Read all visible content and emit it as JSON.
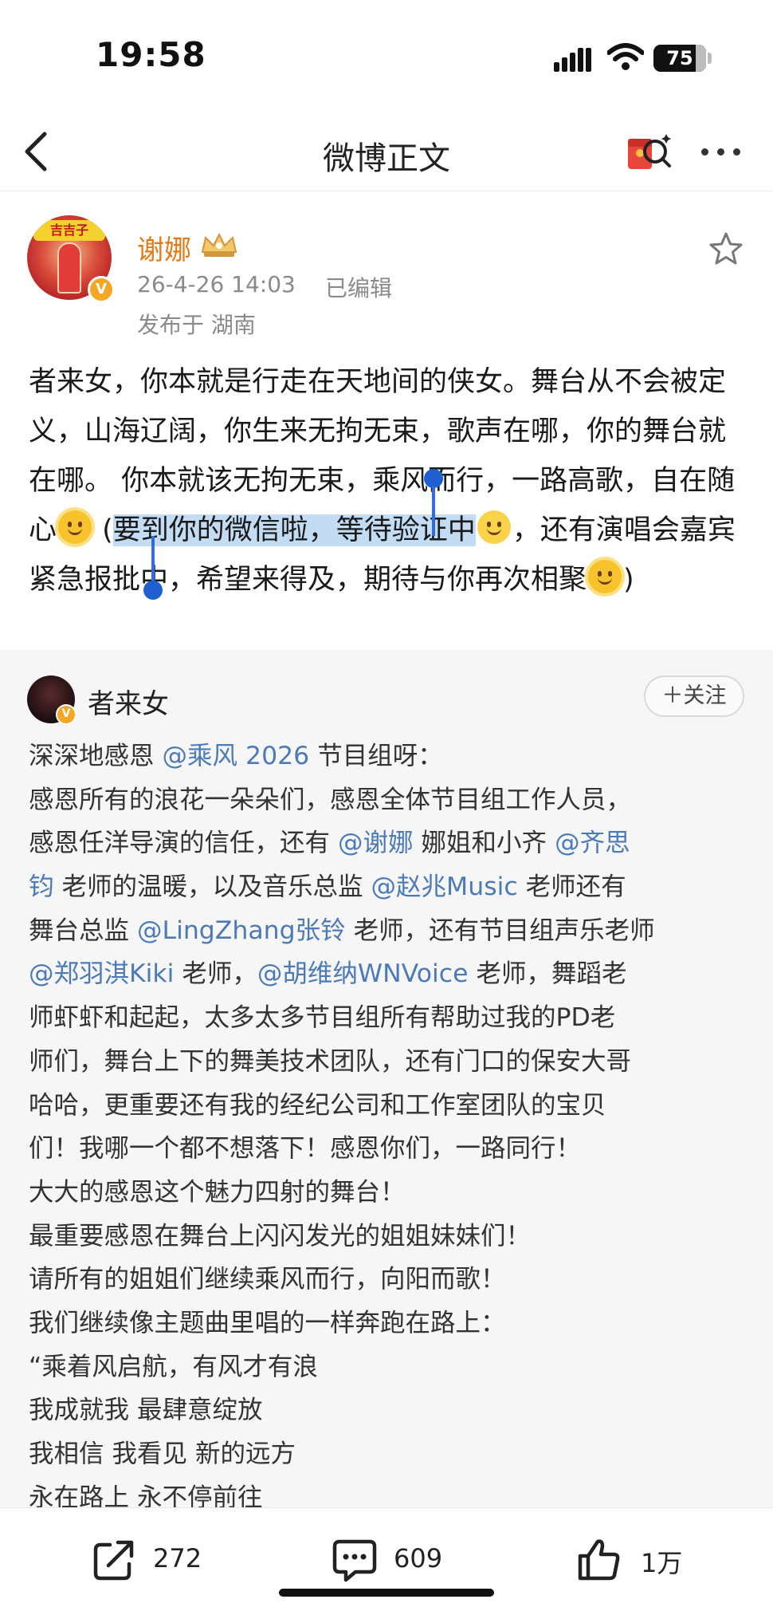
{
  "status_bar": {
    "time": "19:58",
    "battery": "75"
  },
  "nav": {
    "title": "微博正文"
  },
  "post": {
    "author": "谢娜",
    "time": "26-4-26 14:03",
    "edited": "已编辑",
    "location": "发布于 湖南",
    "avatar_banner": "吉吉子",
    "body": {
      "part1": "者来女，你本就是行走在天地间的侠女。舞台从不会被定义，山海辽阔，你生来无拘无束，歌声在哪，你的舞台就在哪。 你本就该无拘无束，乘风而行，一路高歌，自在随心",
      "part2": " (",
      "highlight": "要到你的微信啦，等待验证中",
      "part3": "，还有演唱会嘉宾紧急报批中，希望来得及，期待与你再次相聚",
      "part4": ")"
    }
  },
  "retweet": {
    "author": "者来女",
    "follow_label": "＋关注",
    "lines": [
      {
        "pre": "深深地感恩 ",
        "m1": "@乘风 2026",
        "post": " 节目组呀："
      },
      {
        "pre": "感恩所有的浪花一朵朵们，感恩全体节目组工作人员，",
        "m1": "",
        "post": ""
      },
      {
        "pre": "感恩任洋导演的信任，还有 ",
        "m1": "@谢娜",
        "mid": " 娜姐和小齐 ",
        "m2": "@齐思"
      },
      {
        "m1": "钧",
        "pre": "",
        "post": " 老师的温暖，以及音乐总监 ",
        "m2": "@赵兆Music",
        "post2": " 老师还有"
      },
      {
        "pre": "舞台总监 ",
        "m1": "@LingZhang张铃",
        "post": " 老师，还有节目组声乐老师"
      },
      {
        "m1": "@郑羽淇Kiki",
        "post": " 老师，",
        "m2": "@胡维纳WNVoice",
        "post2": " 老师，舞蹈老"
      },
      {
        "pre": "师虾虾和起起，太多太多节目组所有帮助过我的PD老"
      },
      {
        "pre": "师们，舞台上下的舞美技术团队，还有门口的保安大哥"
      },
      {
        "pre": "哈哈，更重要还有我的经纪公司和工作室团队的宝贝"
      },
      {
        "pre": "们！我哪一个都不想落下！感恩你们，一路同行！"
      },
      {
        "pre": "大大的感恩这个魅力四射的舞台！"
      },
      {
        "pre": "最重要感恩在舞台上闪闪发光的姐姐妹妹们！"
      },
      {
        "pre": "请所有的姐姐们继续乘风而行，向阳而歌！"
      },
      {
        "pre": "我们继续像主题曲里唱的一样奔跑在路上："
      },
      {
        "pre": "“乘着风启航，有风才有浪"
      },
      {
        "pre": "我成就我 最肆意绽放"
      },
      {
        "pre": "我相信 我看见 新的远方"
      },
      {
        "pre": "永在路上 永不停前往"
      }
    ]
  },
  "toolbar": {
    "reposts": "272",
    "comments": "609",
    "likes": "1万"
  },
  "icons": [
    "back-icon",
    "hongbao-icon",
    "more-icon",
    "vip-crown-icon",
    "star-icon",
    "repost-icon",
    "comment-icon",
    "like-icon"
  ]
}
